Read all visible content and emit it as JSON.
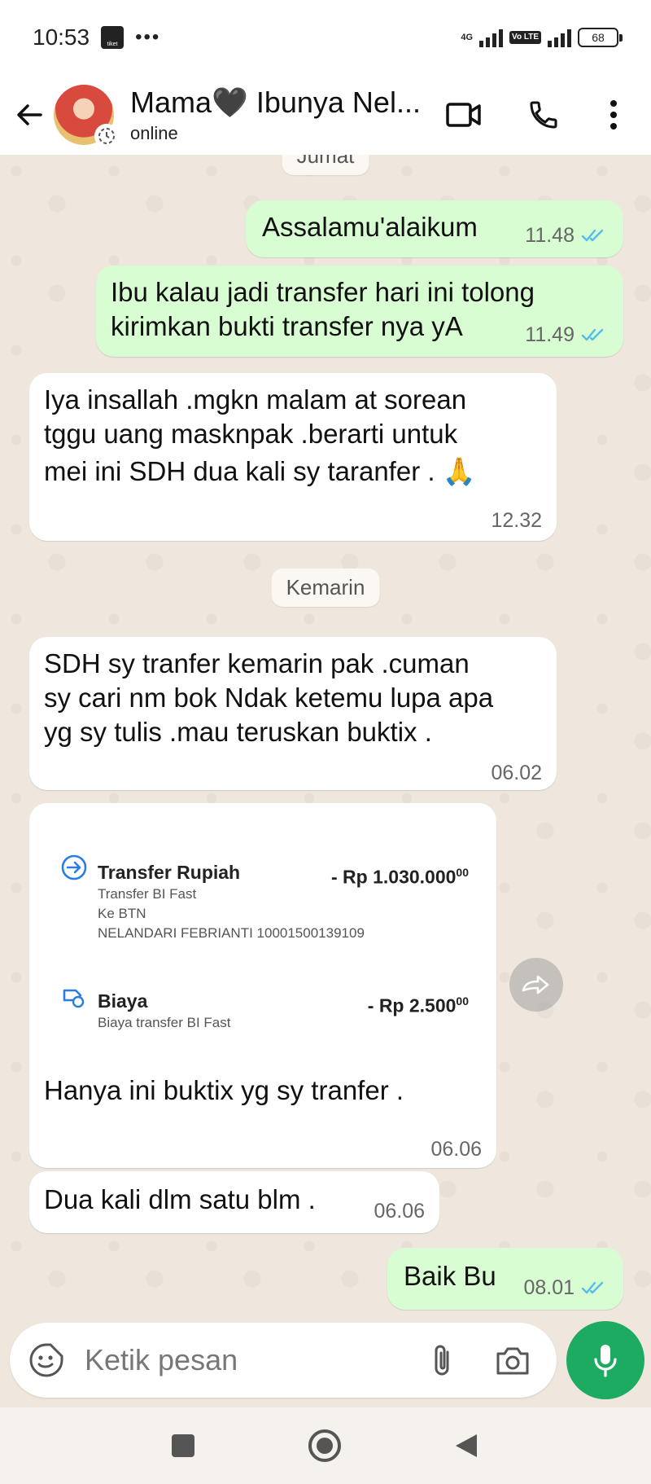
{
  "status_bar": {
    "time": "10:53",
    "notif_app": "tiket",
    "more": "•••",
    "network": "4G",
    "volte": "Vo LTE",
    "battery": "68"
  },
  "header": {
    "contact_name": "Mama🖤 Ibunya Nel...",
    "status": "online"
  },
  "messages": [
    {
      "dir": "in-date",
      "label": "Jumat"
    },
    {
      "dir": "out",
      "text": "Assalamu'alaikum",
      "time": "11.48"
    },
    {
      "dir": "out",
      "text": "Ibu kalau jadi transfer hari ini tolong kirimkan bukti transfer nya yA",
      "line1": "Ibu kalau jadi transfer hari ini tolong",
      "line2": "kirimkan bukti transfer nya yA",
      "time": "11.49"
    },
    {
      "dir": "in",
      "line1": "Iya insallah .mgkn malam at sorean",
      "line2": "tggu uang masknpak .berarti untuk",
      "line3": "mei ini SDH dua kali sy taranfer . 🙏",
      "time": "12.32"
    },
    {
      "dir": "date",
      "label": "Kemarin"
    },
    {
      "dir": "in",
      "line1": "SDH sy tranfer kemarin pak .cuman",
      "line2": "sy cari nm bok Ndak ketemu lupa apa",
      "line3": "yg sy tulis .mau teruskan buktix .",
      "time": "06.02"
    },
    {
      "dir": "in",
      "caption": "Hanya ini buktix yg sy tranfer .",
      "time": "06.06"
    },
    {
      "dir": "in",
      "text": "Dua kali dlm satu blm .",
      "time": "06.06"
    },
    {
      "dir": "out",
      "text": "Baik Bu",
      "time": "08.01"
    }
  ],
  "receipt": {
    "item1_title": "Transfer Rupiah",
    "item1_amount": "- Rp 1.030.000",
    "item1_cents": "00",
    "item1_sub1": "Transfer BI Fast",
    "item1_sub2": "Ke BTN",
    "item1_sub3": "NELANDARI FEBRIANTI 10001500139109",
    "item2_title": "Biaya",
    "item2_amount": "- Rp 2.500",
    "item2_cents": "00",
    "item2_sub1": "Biaya transfer BI Fast"
  },
  "input": {
    "placeholder": "Ketik pesan"
  },
  "colors": {
    "outgoing_bubble": "#d9fdd3",
    "incoming_bubble": "#ffffff",
    "read_ticks": "#53bdeb",
    "mic_button": "#1daa61",
    "chat_bg": "#efe7dd"
  }
}
